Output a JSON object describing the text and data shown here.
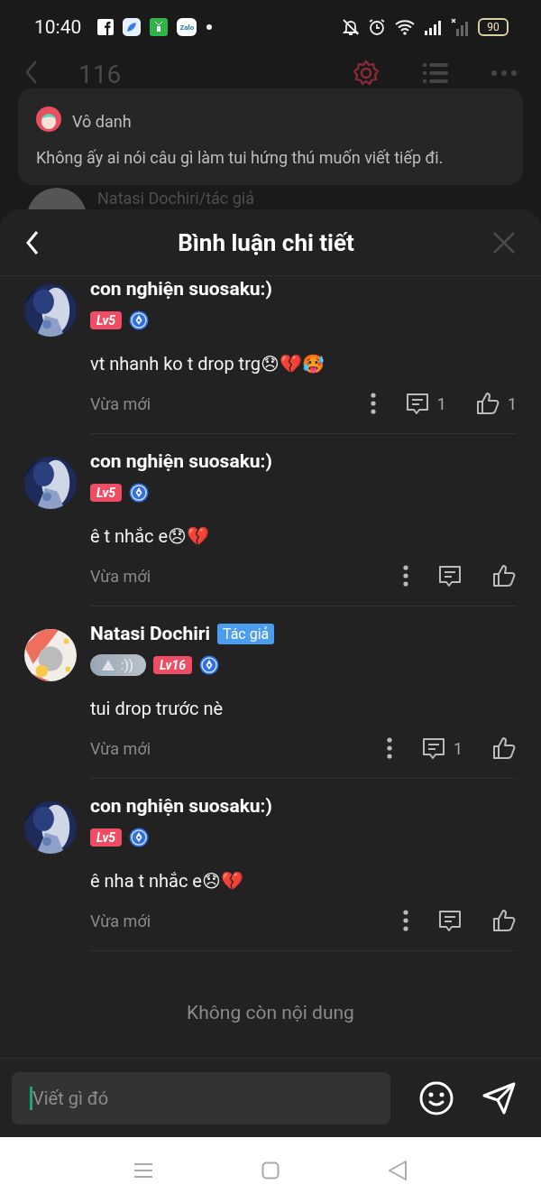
{
  "status_bar": {
    "time": "10:40",
    "app_badge": "Zalo",
    "battery": "90"
  },
  "background_page": {
    "title": "116",
    "pinned_comment": {
      "author": "Vô danh",
      "text": "Không ấy ai nói câu gì làm tui hứng thú muốn viết tiếp đi."
    },
    "next_author": "Natasi Dochiri/tác giả"
  },
  "sheet": {
    "title": "Bình luận chi tiết"
  },
  "comments": [
    {
      "name": "con nghiện suosaku:)",
      "level": "Lv5",
      "text": "vt nhanh ko t drop trg😞💔🥵",
      "time": "Vừa mới",
      "replies": "1",
      "likes": "1"
    },
    {
      "name": "con nghiện suosaku:)",
      "level": "Lv5",
      "text": "ê t nhắc e😞💔",
      "time": "Vừa mới"
    },
    {
      "name": "Natasi Dochiri",
      "author_tag": "Tác giả",
      "title_badge": ":))",
      "level": "Lv16",
      "text": "tui drop trước nè",
      "time": "Vừa mới",
      "replies": "1"
    },
    {
      "name": "con nghiện suosaku:)",
      "level": "Lv5",
      "text": "ê nha t nhắc e😞💔",
      "time": "Vừa mới"
    }
  ],
  "end_text": "Không còn nội dung",
  "composer": {
    "placeholder": "Viết gì đó"
  }
}
